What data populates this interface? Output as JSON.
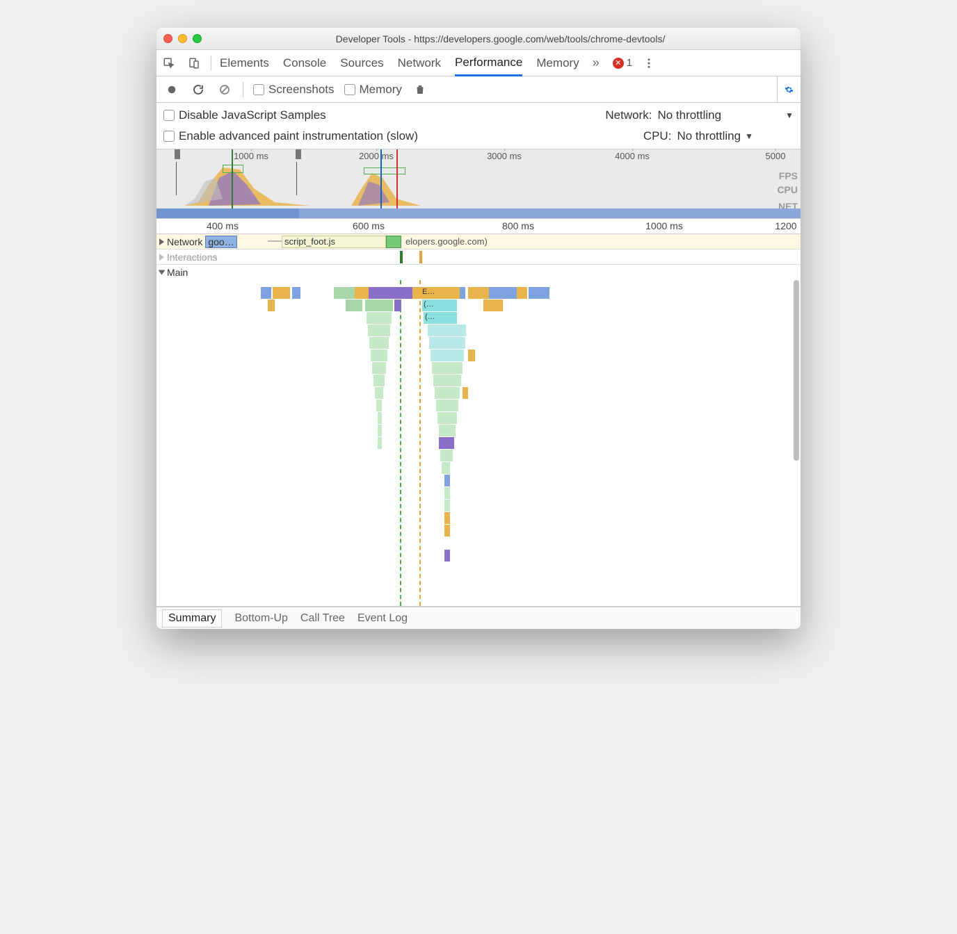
{
  "window": {
    "title": "Developer Tools - https://developers.google.com/web/tools/chrome-devtools/"
  },
  "tabs": {
    "items": [
      "Elements",
      "Console",
      "Sources",
      "Network",
      "Performance",
      "Memory"
    ],
    "active": "Performance",
    "error_count": "1"
  },
  "toolbar": {
    "screenshots_label": "Screenshots",
    "memory_label": "Memory"
  },
  "settings": {
    "disable_js_label": "Disable JavaScript Samples",
    "advanced_paint_label": "Enable advanced paint instrumentation (slow)",
    "network_label": "Network:",
    "network_value": "No throttling",
    "cpu_label": "CPU:",
    "cpu_value": "No throttling"
  },
  "overview": {
    "ticks": [
      "1000 ms",
      "2000 ms",
      "3000 ms",
      "4000 ms",
      "5000"
    ],
    "lanes": {
      "fps": "FPS",
      "cpu": "CPU",
      "net": "NET"
    }
  },
  "detail_ruler": {
    "ticks": [
      "400 ms",
      "600 ms",
      "800 ms",
      "1000 ms",
      "1200"
    ]
  },
  "rows": {
    "network_label": "Network",
    "network_item1": "goo…",
    "network_item2": "script_foot.js",
    "network_item3": "elopers.google.com)",
    "interactions_label": "Interactions",
    "main_label": "Main"
  },
  "flame_labels": {
    "e": "E…",
    "p1": "(…",
    "p2": "(…"
  },
  "bottom_tabs": {
    "items": [
      "Summary",
      "Bottom-Up",
      "Call Tree",
      "Event Log"
    ],
    "active": "Summary"
  }
}
